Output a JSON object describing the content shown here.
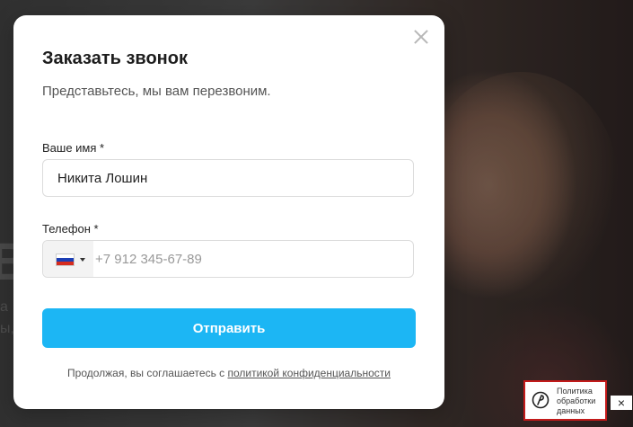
{
  "background": {
    "left_big_text": "B",
    "left_small_1": "a",
    "left_small_2": "ы,"
  },
  "modal": {
    "title": "Заказать звонок",
    "subtitle": "Представьтесь, мы вам перезвоним.",
    "name_field": {
      "label": "Ваше имя *",
      "value": "Никита Лошин"
    },
    "phone_field": {
      "label": "Телефон *",
      "placeholder": "+7 912 345-67-89",
      "country_flag": "russia-flag"
    },
    "submit_label": "Отправить",
    "agree_prefix": "Продолжая, вы соглашаетесь с ",
    "agree_link": "политикой конфиденциальности"
  },
  "policy_widget": {
    "line1": "Политика",
    "line2": "обработки",
    "line3": "данных",
    "close_symbol": "×"
  },
  "colors": {
    "accent": "#1cb6f4",
    "policy_border": "#c31a1a"
  }
}
